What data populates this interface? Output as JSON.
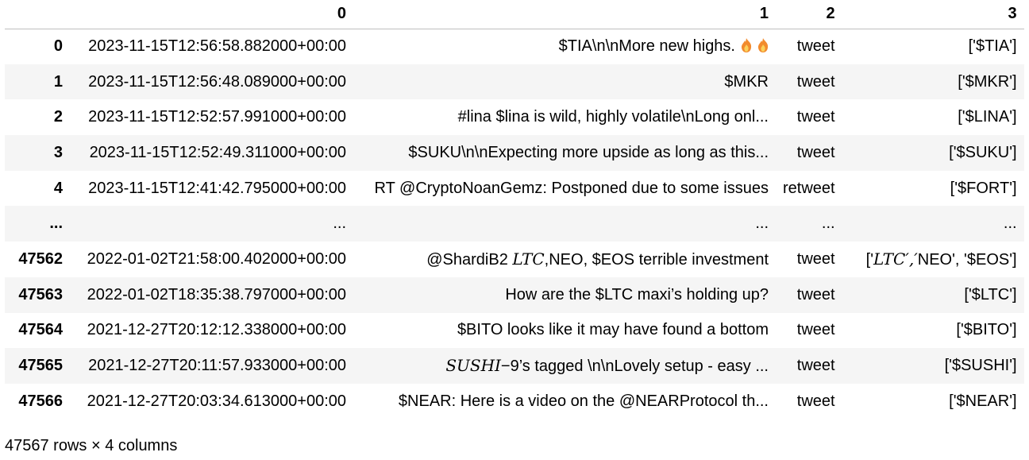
{
  "columns": [
    "0",
    "1",
    "2",
    "3"
  ],
  "rows": [
    {
      "index": "0",
      "c0": "2023-11-15T12:56:58.882000+00:00",
      "c1": "$TIA\\n\\nMore new highs.",
      "c1_icons": [
        "fire-emoji",
        "fire-emoji"
      ],
      "c2": "tweet",
      "c3": "['$TIA']"
    },
    {
      "index": "1",
      "c0": "2023-11-15T12:56:48.089000+00:00",
      "c1": "$MKR",
      "c2": "tweet",
      "c3": "['$MKR']"
    },
    {
      "index": "2",
      "c0": "2023-11-15T12:52:57.991000+00:00",
      "c1": "#lina $lina is wild, highly volatile\\nLong onl...",
      "c2": "tweet",
      "c3": "['$LINA']"
    },
    {
      "index": "3",
      "c0": "2023-11-15T12:52:49.311000+00:00",
      "c1": "$SUKU\\n\\nExpecting more upside as long as this...",
      "c2": "tweet",
      "c3": "['$SUKU']"
    },
    {
      "index": "4",
      "c0": "2023-11-15T12:41:42.795000+00:00",
      "c1": "RT @CryptoNoanGemz: Postponed due to some issues",
      "c2": "retweet",
      "c3": "['$FORT']"
    },
    {
      "index": "...",
      "c0": "...",
      "c1": "...",
      "c2": "...",
      "c3": "..."
    },
    {
      "index": "47562",
      "c0": "2022-01-02T21:58:00.402000+00:00",
      "c1_pre": "@ShardiB2 ",
      "c1_math": "LTC",
      "c1_post": ",NEO, $EOS terrible investment",
      "c2": "tweet",
      "c3_pre": "['",
      "c3_math": "LTC′,′",
      "c3_post": "NEO', '$EOS']"
    },
    {
      "index": "47563",
      "c0": "2022-01-02T18:35:38.797000+00:00",
      "c1": "How are the $LTC maxi’s holding up?",
      "c2": "tweet",
      "c3": "['$LTC']"
    },
    {
      "index": "47564",
      "c0": "2021-12-27T20:12:12.338000+00:00",
      "c1": "$BITO looks like it may have found a bottom",
      "c2": "tweet",
      "c3": "['$BITO']"
    },
    {
      "index": "47565",
      "c0": "2021-12-27T20:11:57.933000+00:00",
      "c1_math": "SUSHI",
      "c1_post": "−9’s tagged \\n\\nLovely setup - easy ...",
      "c2": "tweet",
      "c3": "['$SUSHI']"
    },
    {
      "index": "47566",
      "c0": "2021-12-27T20:03:34.613000+00:00",
      "c1": "$NEAR: Here is a video on the @NEARProtocol th...",
      "c2": "tweet",
      "c3": "['$NEAR']"
    }
  ],
  "shape_text": "47567 rows × 4 columns",
  "colors": {
    "row_stripe": "#f5f5f5",
    "header_rule": "#bfbfbf",
    "flame_outer": "#f28b2e",
    "flame_inner": "#fbd15b"
  }
}
